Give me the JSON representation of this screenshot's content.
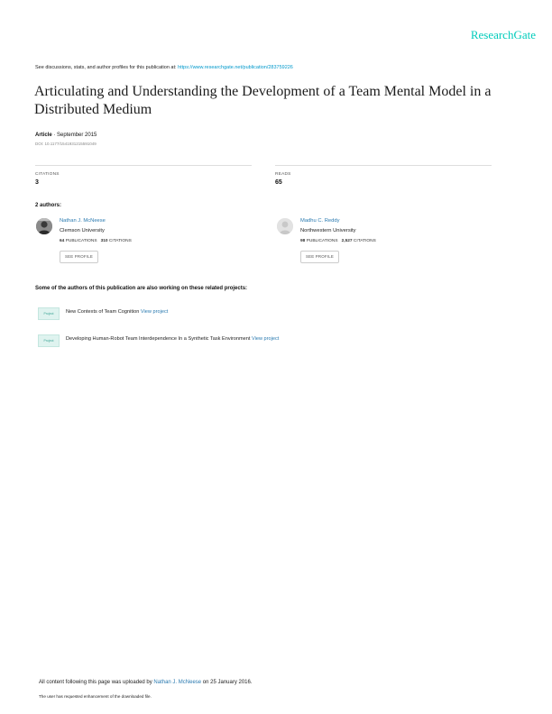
{
  "brand": "ResearchGate",
  "header": {
    "notice_prefix": "See discussions, stats, and author profiles for this publication at:",
    "notice_url": "https://www.researchgate.net/publication/283759226"
  },
  "publication": {
    "title": "Articulating and Understanding the Development of a Team Mental Model in a Distributed Medium",
    "type": "Article",
    "date": "· September 2015",
    "doi": "DOI: 10.1177/1541931215591049"
  },
  "stats": {
    "citations_label": "CITATIONS",
    "citations_value": "3",
    "reads_label": "READS",
    "reads_value": "65"
  },
  "authors_heading": "2 authors:",
  "authors": [
    {
      "name": "Nathan J. McNeese",
      "institution": "Clemson University",
      "publications": "64",
      "publications_label": "PUBLICATIONS",
      "citations": "310",
      "citations_label": "CITATIONS",
      "button": "SEE PROFILE"
    },
    {
      "name": "Madhu C. Reddy",
      "institution": "Northwestern University",
      "publications": "98",
      "publications_label": "PUBLICATIONS",
      "citations": "2,527",
      "citations_label": "CITATIONS",
      "button": "SEE PROFILE"
    }
  ],
  "related_heading": "Some of the authors of this publication are also working on these related projects:",
  "projects": [
    {
      "badge": "Project",
      "title": "New Contexts of Team Cognition",
      "link": "View project"
    },
    {
      "badge": "Project",
      "title": "Developing Human-Robot Team Interdependence In a Synthetic Task Environment",
      "link": "View project"
    }
  ],
  "footer": {
    "upload_prefix": "All content following this page was uploaded by",
    "uploader": "Nathan J. McNeese",
    "upload_suffix": "on 25 January 2016.",
    "enhancement_note": "The user has requested enhancement of the downloaded file."
  }
}
